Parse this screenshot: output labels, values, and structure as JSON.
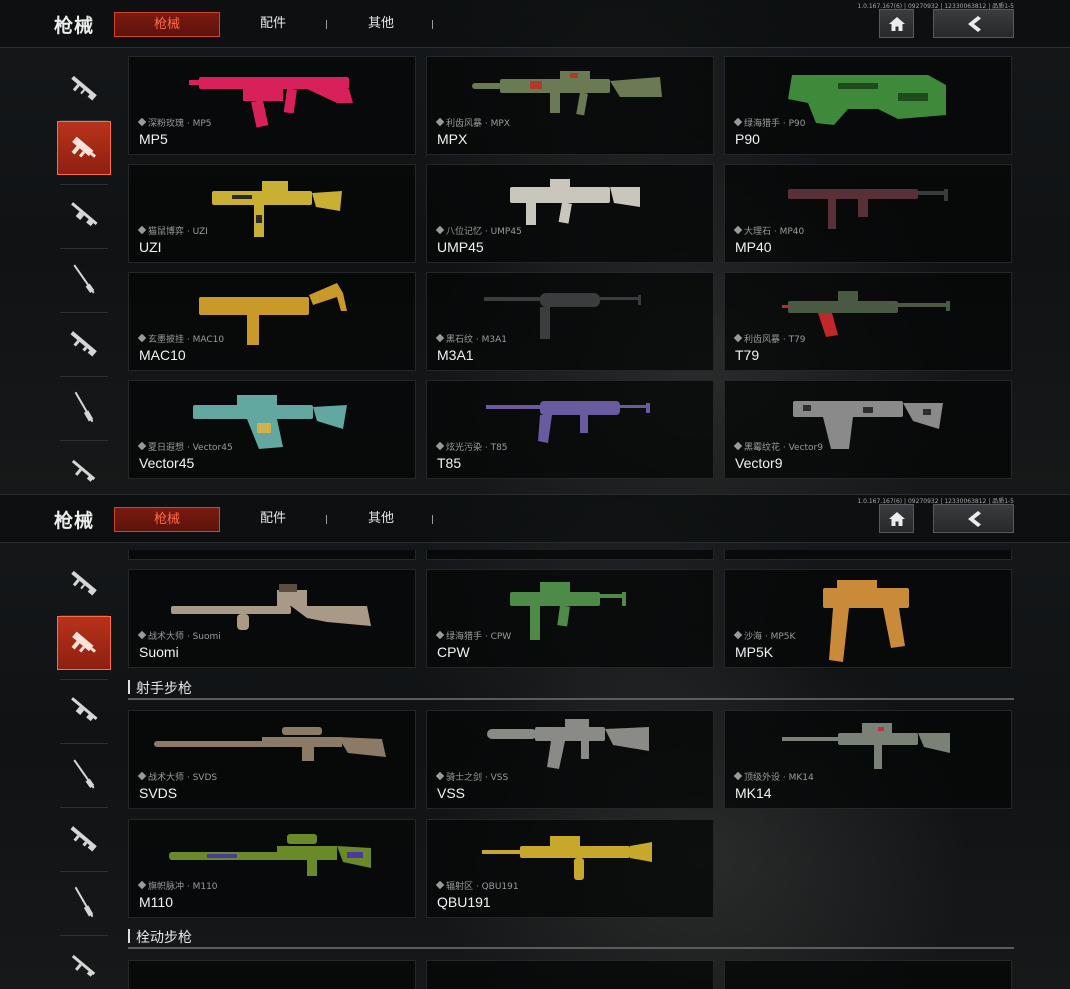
{
  "version": "1.0.167.167(6) | 09270932 | 12330063812 | 品质1-5",
  "header": {
    "title": "枪械",
    "tabs": [
      {
        "label": "枪械",
        "active": true
      },
      {
        "label": "配件",
        "active": false
      },
      {
        "label": "其他",
        "active": false
      }
    ],
    "home_icon": "home-icon",
    "back_icon": "chevron-left-icon"
  },
  "colors": {
    "accent": "#d0452c",
    "accent_text": "#ff6a4a",
    "card_bg": "#050607",
    "text": "#f2f2f2",
    "subtext": "#9a9a9a"
  },
  "sidebar": {
    "categories": [
      {
        "icon": "assault-rifle-icon"
      },
      {
        "icon": "submachine-gun-icon",
        "active": true
      },
      {
        "icon": "light-machine-gun-icon"
      },
      {
        "icon": "marksman-rifle-icon"
      },
      {
        "icon": "shotgun-icon"
      },
      {
        "icon": "bolt-action-rifle-icon"
      },
      {
        "icon": "pistol-icon"
      }
    ]
  },
  "view1": {
    "cards": [
      {
        "skin": "深粉玫瑰 · MP5",
        "name": "MP5",
        "color": "#d8205a"
      },
      {
        "skin": "利齿风暴 · MPX",
        "name": "MPX",
        "color": "#6a7a52"
      },
      {
        "skin": "绿海猎手 · P90",
        "name": "P90",
        "color": "#3f8a3a"
      },
      {
        "skin": "猫鼠博弈 · UZI",
        "name": "UZI",
        "color": "#c9b032"
      },
      {
        "skin": "八位记忆 · UMP45",
        "name": "UMP45",
        "color": "#c9c6bb"
      },
      {
        "skin": "大理石 · MP40",
        "name": "MP40",
        "color": "#5a3038"
      },
      {
        "skin": "玄墨披挂 · MAC10",
        "name": "MAC10",
        "color": "#c99a2a"
      },
      {
        "skin": "黑石纹 · M3A1",
        "name": "M3A1",
        "color": "#3a3c3e"
      },
      {
        "skin": "利齿风暴 · T79",
        "name": "T79",
        "color": "#4a5a42"
      },
      {
        "skin": "夏日遐想 · Vector45",
        "name": "Vector45",
        "color": "#62a8a0"
      },
      {
        "skin": "炫光污染 · T85",
        "name": "T85",
        "color": "#6a5aa0"
      },
      {
        "skin": "黑霉纹花 · Vector9",
        "name": "Vector9",
        "color": "#8a8a8a"
      }
    ]
  },
  "view2": {
    "cards": [
      {
        "skin": "战术大师 · Suomi",
        "name": "Suomi",
        "color": "#a89a86"
      },
      {
        "skin": "绿海猎手 · CPW",
        "name": "CPW",
        "color": "#4e8a48"
      },
      {
        "skin": "沙海 · MP5K",
        "name": "MP5K",
        "color": "#c98a3a"
      }
    ],
    "section_marksman": "射手步枪",
    "cards_marksman": [
      {
        "skin": "战术大师 · SVDS",
        "name": "SVDS",
        "color": "#8a7a66"
      },
      {
        "skin": "骑士之剑 · VSS",
        "name": "VSS",
        "color": "#8a8a86"
      },
      {
        "skin": "顶级外设 · MK14",
        "name": "MK14",
        "color": "#7a8278"
      },
      {
        "skin": "旗帜脉冲 · M110",
        "name": "M110",
        "color": "#6a8a2a"
      },
      {
        "skin": "辐射区 · QBU191",
        "name": "QBU191",
        "color": "#c8a82a"
      }
    ],
    "section_bolt": "栓动步枪"
  }
}
